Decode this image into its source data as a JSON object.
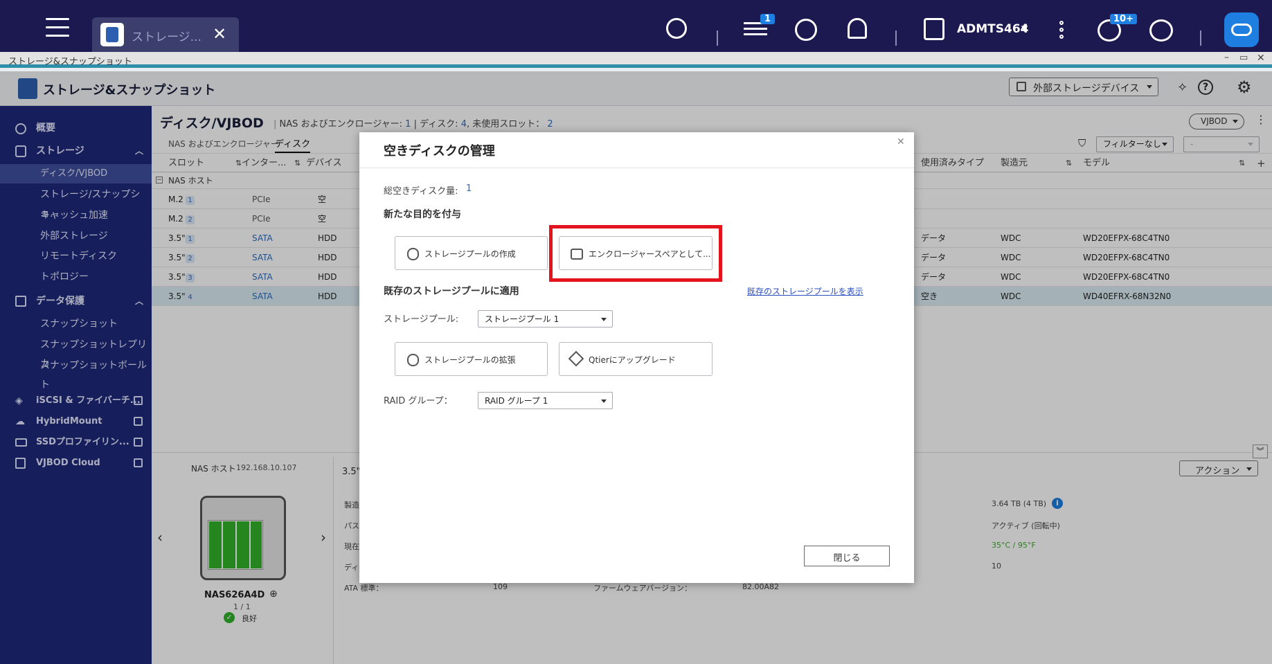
{
  "topbar": {
    "tab_label": "ストレージ...",
    "update_badge": "1",
    "username": "ADMTS464",
    "notif_badge": "10+"
  },
  "window": {
    "title": "ストレージ&スナップショット"
  },
  "app_header": {
    "title": "ストレージ&スナップショット",
    "external_devices_label": "外部ストレージデバイス"
  },
  "sidebar": {
    "overview": "概要",
    "storage": "ストレージ",
    "storage_items": [
      "ディスク/VJBOD",
      "ストレージ/スナップショ...",
      "キャッシュ加速",
      "外部ストレージ",
      "リモートディスク",
      "トポロジー"
    ],
    "data_protection": "データ保護",
    "protection_items": [
      "スナップショット",
      "スナップショットレプリカ",
      "スナップショットボールト"
    ],
    "links": [
      "iSCSI & ファイバーチ...",
      "HybridMount",
      "SSDプロファイリン...",
      "VJBOD Cloud"
    ]
  },
  "main": {
    "page_title": "ディスク/VJBOD",
    "summary_prefix": "NAS およびエンクロージャー:",
    "summary_enclosures": "1",
    "summary_disks_label": "| ディスク:",
    "summary_disks": "4",
    "summary_slots_label": ", 未使用スロット：",
    "summary_slots": "2",
    "vjbod_button": "VJBOD",
    "tabs": [
      "NAS およびエンクロージャー",
      "ディスク"
    ],
    "filter_label": "フィルターなし",
    "filter_value": "-",
    "columns": [
      "スロット",
      "インター...",
      "デバイス",
      "使用済みタイプ",
      "製造元",
      "モデル"
    ],
    "group_label": "NAS ホスト",
    "rows": [
      {
        "slot": "M.2",
        "num": "1",
        "iface": "PCIe",
        "device": "空",
        "used": "",
        "vendor": "",
        "model": ""
      },
      {
        "slot": "M.2",
        "num": "2",
        "iface": "PCIe",
        "device": "空",
        "used": "",
        "vendor": "",
        "model": ""
      },
      {
        "slot": "3.5\"",
        "num": "1",
        "iface": "SATA",
        "device": "HDD",
        "used": "データ",
        "vendor": "WDC",
        "model": "WD20EFPX-68C4TN0"
      },
      {
        "slot": "3.5\"",
        "num": "2",
        "iface": "SATA",
        "device": "HDD",
        "used": "データ",
        "vendor": "WDC",
        "model": "WD20EFPX-68C4TN0"
      },
      {
        "slot": "3.5\"",
        "num": "3",
        "iface": "SATA",
        "device": "HDD",
        "used": "データ",
        "vendor": "WDC",
        "model": "WD20EFPX-68C4TN0"
      },
      {
        "slot": "3.5\"",
        "num": "4",
        "iface": "SATA",
        "device": "HDD",
        "used": "空き",
        "vendor": "WDC",
        "model": "WD40EFRX-68N32N0"
      }
    ],
    "detail": {
      "host_label": "NAS ホスト",
      "host_ip": "192.168.10.107",
      "device_name": "NAS626A4D",
      "page": "1 / 1",
      "status": "良好",
      "slot_title": "3.5\"",
      "action_button": "アクション",
      "left_labels": [
        "製造",
        "パス",
        "現在",
        "ディ",
        "ATA 標準："
      ],
      "ata_value": "109",
      "firmware_label": "ファームウェアバージョン：",
      "firmware_value": "82.00A82",
      "capacity": "3.64 TB (4 TB)",
      "state": "アクティブ (回転中)",
      "temperature": "35°C / 95°F",
      "count": "10"
    }
  },
  "dialog": {
    "title": "空きディスクの管理",
    "total_label": "総空きディスク量:",
    "total_value": "1",
    "new_purpose": "新たな目的を付与",
    "create_pool": "ストレージプールの作成",
    "enclosure_spare": "エンクロージャースペアとして...",
    "apply_existing": "既存のストレージプールに適用",
    "show_existing_link": "既存のストレージプールを表示",
    "pool_label": "ストレージプール:",
    "pool_value": "ストレージプール 1",
    "expand_pool": "ストレージプールの拡張",
    "qtier_upgrade": "Qtierにアップグレード",
    "raid_label": "RAID グループ：",
    "raid_value": "RAID グループ 1",
    "close_button": "閉じる",
    "highlight_color": "#e3141b"
  }
}
